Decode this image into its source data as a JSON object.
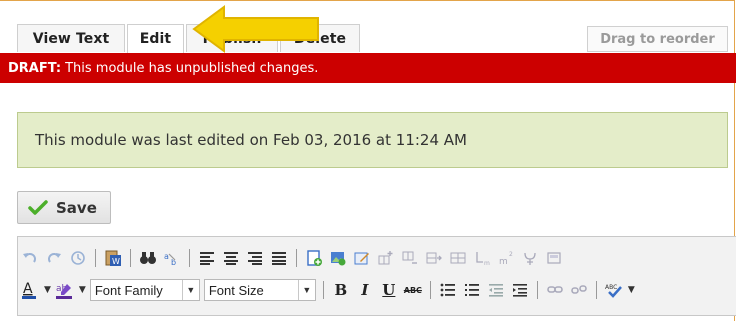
{
  "tabs": [
    {
      "label": "View Text",
      "active": false
    },
    {
      "label": "Edit",
      "active": true
    },
    {
      "label": "Publish",
      "active": false
    },
    {
      "label": "Delete",
      "active": false
    }
  ],
  "drag_reorder_label": "Drag to reorder",
  "draft_banner": {
    "prefix": "DRAFT:",
    "message": "This module has unpublished changes."
  },
  "info_box": {
    "message": "This module was last edited on Feb 03, 2016 at 11:24 AM"
  },
  "save_button": {
    "label": "Save"
  },
  "toolbar": {
    "font_family": "Font Family",
    "font_size": "Font Size",
    "bold_glyph": "B",
    "italic_glyph": "I",
    "underline_glyph": "U",
    "strike_glyph": "ABC"
  },
  "colors": {
    "draft_red": "#cc0000",
    "info_green": "#e4edc9",
    "arrow_yellow": "#f5d000",
    "page_border": "#e3a44a"
  },
  "icons": [
    "undo-icon",
    "redo-icon",
    "history-icon",
    "paste-word-icon",
    "find-icon",
    "find-replace-icon",
    "align-left-icon",
    "align-center-icon",
    "align-right-icon",
    "align-justify-icon",
    "insert-file-icon",
    "insert-image-icon",
    "edit-image-icon",
    "insert-row-icon",
    "delete-row-icon",
    "insert-column-icon",
    "table-icon",
    "subscript-icon",
    "superscript-icon",
    "special-char-icon",
    "templates-icon",
    "font-color-icon",
    "highlight-icon",
    "bullet-list-icon",
    "numbered-list-icon",
    "outdent-icon",
    "indent-icon",
    "link-icon",
    "unlink-icon",
    "spellcheck-icon"
  ]
}
